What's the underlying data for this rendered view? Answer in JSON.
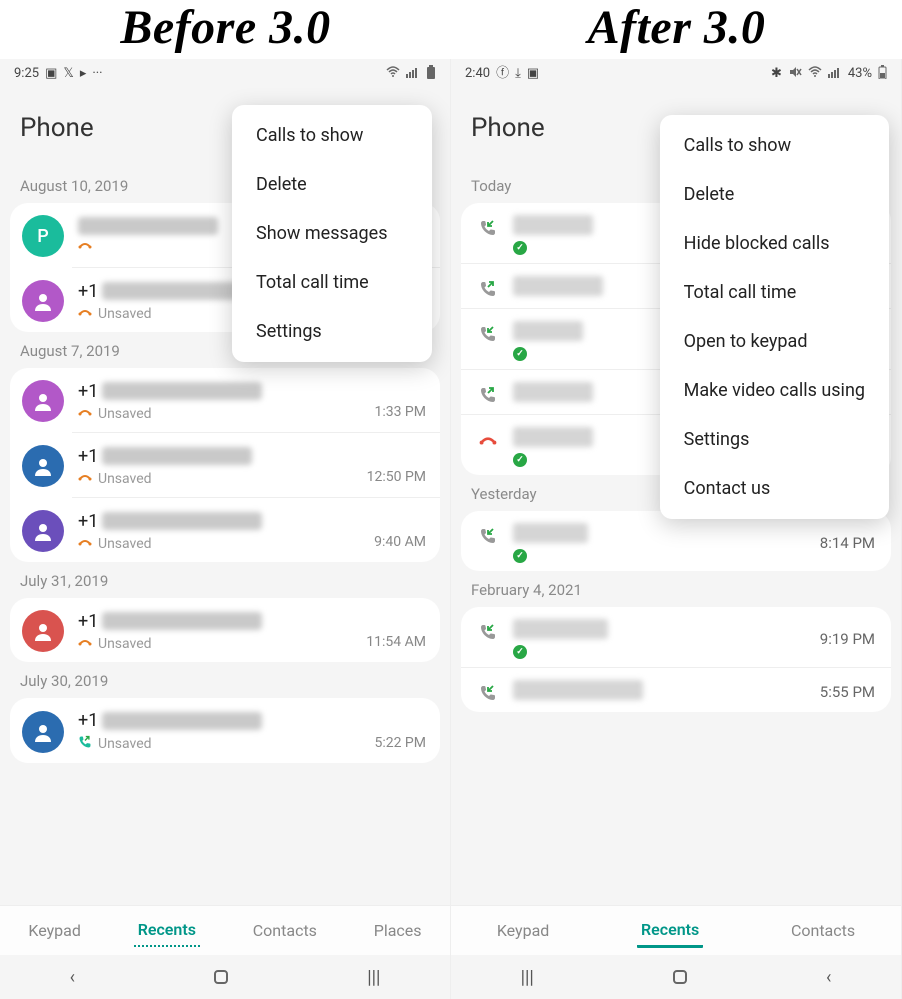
{
  "titles": {
    "left": "Before 3.0",
    "right": "After 3.0"
  },
  "left": {
    "status": {
      "time": "9:25",
      "icons_left": [
        "▢",
        "🐦",
        "▶",
        "···"
      ],
      "icons_right": [
        "📶",
        "📊",
        "🔋"
      ]
    },
    "header": "Phone",
    "sections": [
      {
        "label": "August 10, 2019",
        "calls": [
          {
            "avatar_color": "#1abc9c",
            "avatar_letter": "P",
            "prefix": "",
            "blur_w": 140,
            "status_icon": "missed",
            "status_text": "",
            "time": ""
          },
          {
            "avatar_color": "#b258c8",
            "avatar_letter": "",
            "prefix": "+1",
            "blur_w": 140,
            "status_icon": "missed",
            "status_text": "Unsaved",
            "time": ""
          }
        ]
      },
      {
        "label": "August 7, 2019",
        "calls": [
          {
            "avatar_color": "#b258c8",
            "avatar_letter": "",
            "prefix": "+1",
            "blur_w": 160,
            "status_icon": "missed",
            "status_text": "Unsaved",
            "time": "1:33 PM"
          },
          {
            "avatar_color": "#2b6cb0",
            "avatar_letter": "",
            "prefix": "+1",
            "blur_w": 150,
            "status_icon": "missed",
            "status_text": "Unsaved",
            "time": "12:50 PM"
          },
          {
            "avatar_color": "#6b4fbb",
            "avatar_letter": "",
            "prefix": "+1",
            "blur_w": 160,
            "status_icon": "missed",
            "status_text": "Unsaved",
            "time": "9:40 AM"
          }
        ]
      },
      {
        "label": "July 31, 2019",
        "calls": [
          {
            "avatar_color": "#d9534f",
            "avatar_letter": "",
            "prefix": "+1",
            "blur_w": 160,
            "status_icon": "missed",
            "status_text": "Unsaved",
            "time": "11:54 AM"
          }
        ]
      },
      {
        "label": "July 30, 2019",
        "calls": [
          {
            "avatar_color": "#2b6cb0",
            "avatar_letter": "",
            "prefix": "+1",
            "blur_w": 160,
            "status_icon": "outgoing",
            "status_text": "Unsaved",
            "time": "5:22 PM"
          }
        ]
      }
    ],
    "popup": [
      "Calls to show",
      "Delete",
      "Show messages",
      "Total call time",
      "Settings"
    ],
    "tabs": [
      "Keypad",
      "Recents",
      "Contacts",
      "Places"
    ],
    "active_tab": 1
  },
  "right": {
    "status": {
      "time": "2:40",
      "icons_left": [
        "⬤",
        "✓",
        "▢"
      ],
      "battery": "43%",
      "icons_right": [
        "✱",
        "🔇",
        "📶",
        "📊"
      ]
    },
    "header": "Phone",
    "sections": [
      {
        "label": "Today",
        "calls": [
          {
            "dir": "in",
            "blur_w": 80,
            "check": true,
            "time": ""
          },
          {
            "dir": "out",
            "blur_w": 90,
            "check": false,
            "time": ""
          },
          {
            "dir": "in",
            "blur_w": 70,
            "check": true,
            "time": ""
          },
          {
            "dir": "out",
            "blur_w": 80,
            "check": false,
            "time": ""
          },
          {
            "dir": "missed",
            "blur_w": 80,
            "check": true,
            "time": ""
          }
        ]
      },
      {
        "label": "Yesterday",
        "calls": [
          {
            "dir": "in",
            "blur_w": 75,
            "check": true,
            "time": "8:14 PM"
          }
        ]
      },
      {
        "label": "February 4, 2021",
        "calls": [
          {
            "dir": "in",
            "blur_w": 95,
            "check": true,
            "time": "9:19 PM"
          },
          {
            "dir": "in",
            "blur_w": 130,
            "check": false,
            "time": "5:55 PM"
          }
        ]
      }
    ],
    "popup": [
      "Calls to show",
      "Delete",
      "Hide blocked calls",
      "Total call time",
      "Open to keypad",
      "Make video calls using",
      "Settings",
      "Contact us"
    ],
    "tabs": [
      "Keypad",
      "Recents",
      "Contacts"
    ],
    "active_tab": 1
  }
}
